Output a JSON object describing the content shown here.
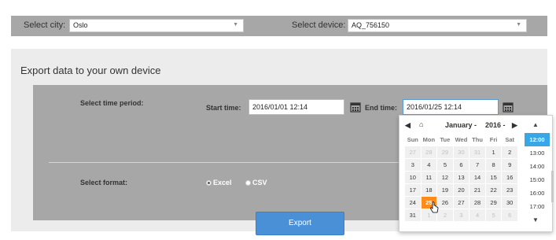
{
  "top": {
    "city_label": "Select city:",
    "city_value": "Oslo",
    "device_label": "Select device:",
    "device_value": "AQ_756150"
  },
  "export": {
    "title": "Export data to your own device",
    "time_period_label": "Select time period:",
    "start_label": "Start time:",
    "start_value": "2016/01/01 12:14",
    "end_label": "End time:",
    "end_value": "2016/01/25 12:14",
    "format_label": "Select format:",
    "formats": [
      {
        "label": "Excel",
        "selected": true
      },
      {
        "label": "CSV",
        "selected": false
      }
    ],
    "button": "Export"
  },
  "picker": {
    "prev": "◀",
    "home": "⌂",
    "month": "January -",
    "year": "2016 -",
    "next": "▶",
    "weekdays": [
      "Sun",
      "Mon",
      "Tue",
      "Wed",
      "Thu",
      "Fri",
      "Sat"
    ],
    "weeks": [
      [
        "27",
        "28",
        "29",
        "30",
        "31",
        "1",
        "2"
      ],
      [
        "3",
        "4",
        "5",
        "6",
        "7",
        "8",
        "9"
      ],
      [
        "10",
        "11",
        "12",
        "13",
        "14",
        "15",
        "16"
      ],
      [
        "17",
        "18",
        "19",
        "20",
        "21",
        "22",
        "23"
      ],
      [
        "24",
        "25",
        "26",
        "27",
        "28",
        "29",
        "30"
      ],
      [
        "31",
        "1",
        "2",
        "3",
        "4",
        "5",
        "6"
      ]
    ],
    "muted": [
      [
        0,
        0
      ],
      [
        0,
        1
      ],
      [
        0,
        2
      ],
      [
        0,
        3
      ],
      [
        0,
        4
      ],
      [
        5,
        1
      ],
      [
        5,
        2
      ],
      [
        5,
        3
      ],
      [
        5,
        4
      ],
      [
        5,
        5
      ],
      [
        5,
        6
      ]
    ],
    "selected_cell": [
      4,
      1
    ],
    "times": [
      "12:00",
      "13:00",
      "14:00",
      "15:00",
      "16:00",
      "17:00"
    ],
    "active_time": "12:00",
    "selected_color": "#ff8c1a",
    "active_time_color": "#3aa6e6"
  },
  "colors": {
    "accent": "#4a90d6",
    "header_bg": "#a7a7a7",
    "panel_bg": "#ececec"
  }
}
